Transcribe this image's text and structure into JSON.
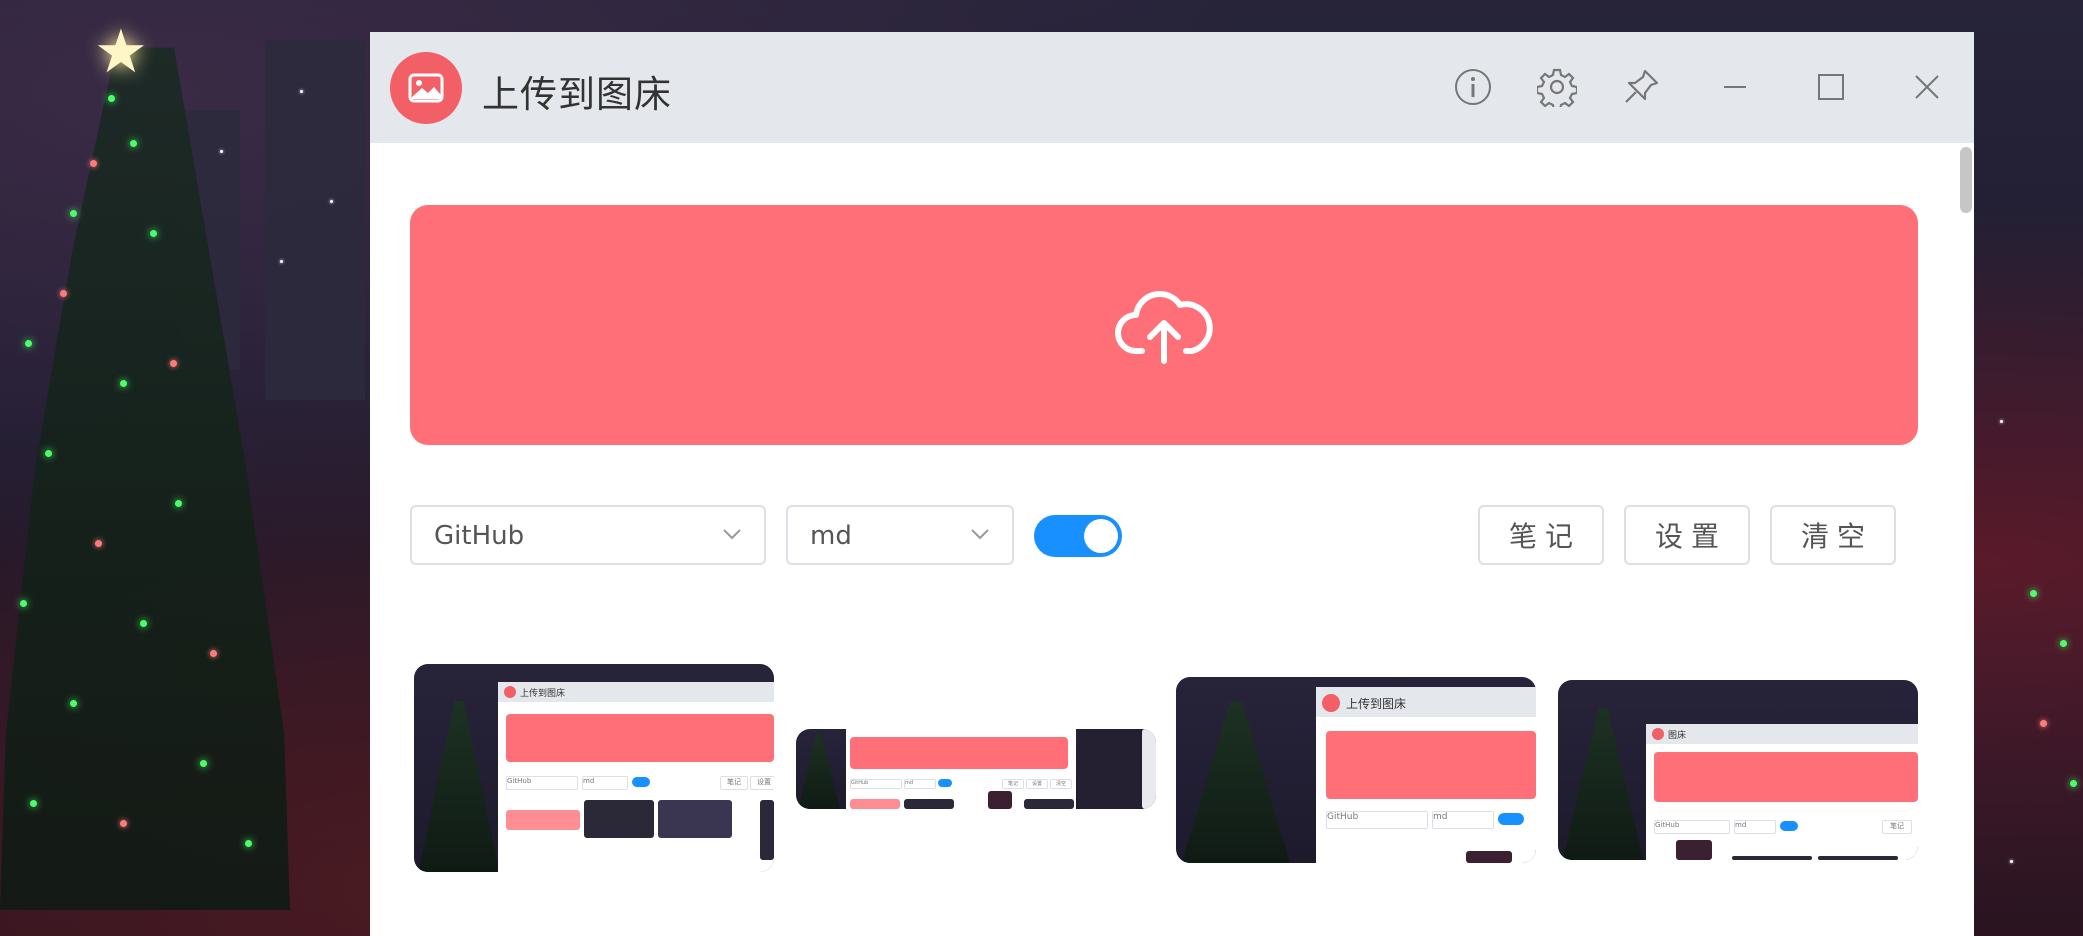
{
  "window": {
    "title": "上传到图床",
    "icons": {
      "logo": "image-icon",
      "info": "info-icon",
      "settings": "gear-icon",
      "pin": "pin-icon",
      "minimize": "minimize-icon",
      "maximize": "maximize-icon",
      "close": "close-icon"
    }
  },
  "upload": {
    "icon": "cloud-upload-icon"
  },
  "controls": {
    "host_select": {
      "value": "GitHub"
    },
    "format_select": {
      "value": "md"
    },
    "toggle": {
      "on": true
    },
    "buttons": {
      "notes": "笔记",
      "settings": "设置",
      "clear": "清空"
    }
  },
  "thumbnails": [
    {
      "title": "上传到图床",
      "host": "GitHub",
      "format": "md",
      "buttons": [
        "笔记",
        "设置"
      ]
    },
    {
      "host": "GitHub",
      "format": "md",
      "buttons": [
        "笔记",
        "设置",
        "清空"
      ]
    },
    {
      "title": "上传到图床",
      "host": "GitHub",
      "format": "md"
    },
    {
      "title": "图床",
      "host": "GitHub",
      "format": "md",
      "buttons": [
        "笔记"
      ]
    }
  ],
  "colors": {
    "accent": "#ff6f78",
    "logo": "#f25f67",
    "toggle": "#1890ff",
    "titlebar": "#e4e7eb"
  }
}
